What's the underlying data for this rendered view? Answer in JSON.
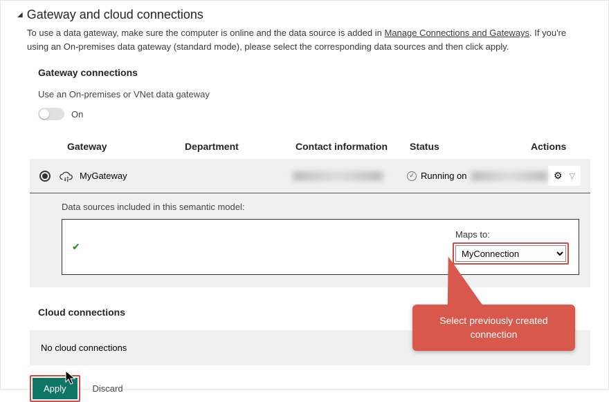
{
  "section": {
    "title": "Gateway and cloud connections",
    "desc_before": "To use a data gateway, make sure the computer is online and the data source is added in ",
    "desc_link": "Manage Connections and Gateways",
    "desc_after": ". If you're using an On-premises data gateway (standard mode), please select the corresponding data sources and then click apply."
  },
  "gateway": {
    "heading": "Gateway connections",
    "hint": "Use an On-premises or VNet data gateway",
    "toggle_label": "On",
    "cols": {
      "gw": "Gateway",
      "dep": "Department",
      "ci": "Contact information",
      "st": "Status",
      "ac": "Actions"
    },
    "row": {
      "name": "MyGateway",
      "status_prefix": "Running on"
    },
    "ds_label": "Data sources included in this semantic model:",
    "maps_label": "Maps to:",
    "selected": "MyConnection"
  },
  "cloud": {
    "heading": "Cloud connections",
    "empty": "No cloud connections"
  },
  "buttons": {
    "apply": "Apply",
    "discard": "Discard"
  },
  "callout": "Select previously created connection"
}
